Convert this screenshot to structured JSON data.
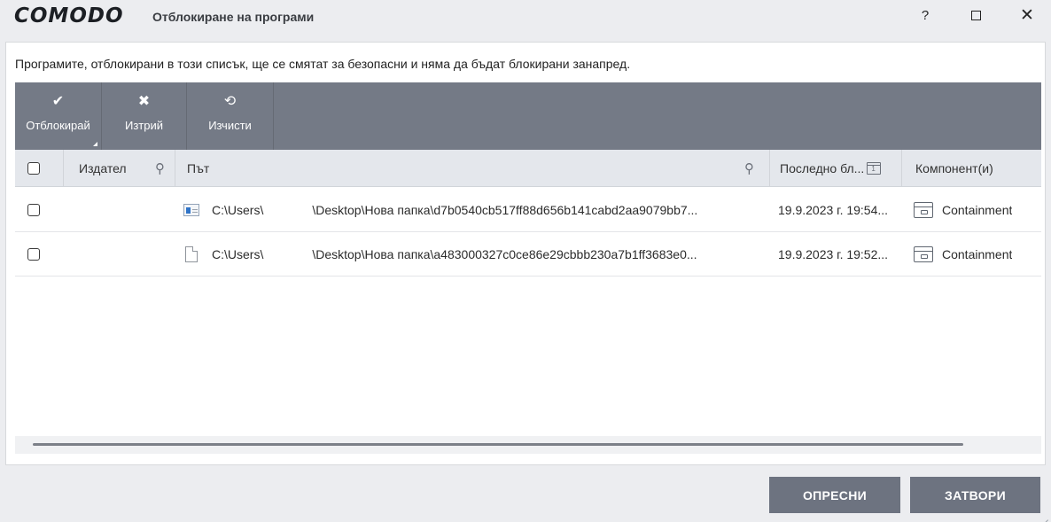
{
  "window": {
    "brand": "COMODO",
    "title": "Отблокиране на програми",
    "help": "?",
    "maximize": "",
    "close": "✕"
  },
  "description": "Програмите, отблокирани в този списък, ще се смятат за безопасни и няма да бъдат блокирани занапред.",
  "toolbar": {
    "unblock": {
      "icon": "check-icon",
      "label": "Отблокирай"
    },
    "delete": {
      "icon": "x-icon",
      "label": "Изтрий"
    },
    "clear": {
      "icon": "refresh-icon",
      "label": "Изчисти"
    }
  },
  "columns": {
    "publisher": "Издател",
    "path": "Път",
    "last_blocked": "Последно бл...",
    "components": "Компонент(и)"
  },
  "rows": [
    {
      "checked": false,
      "publisher": "",
      "path_prefix": "C:\\Users\\",
      "path_suffix": "\\Desktop\\Нова папка\\d7b0540cb517ff88d656b141cabd2aa9079bb7...",
      "icon": "exe-icon",
      "last_blocked": "19.9.2023 г. 19:54...",
      "component": "Containment"
    },
    {
      "checked": false,
      "publisher": "",
      "path_prefix": "C:\\Users\\",
      "path_suffix": "\\Desktop\\Нова папка\\a483000327c0ce86e29cbbb230a7b1ff3683e0...",
      "icon": "file-icon",
      "last_blocked": "19.9.2023 г. 19:52...",
      "component": "Containment"
    }
  ],
  "buttons": {
    "refresh": "ОПРЕСНИ",
    "close": "ЗАТВОРИ"
  },
  "colors": {
    "toolbar": "#747a86",
    "header": "#e4e7ec",
    "button": "#6d7380",
    "background": "#ecedf0"
  }
}
